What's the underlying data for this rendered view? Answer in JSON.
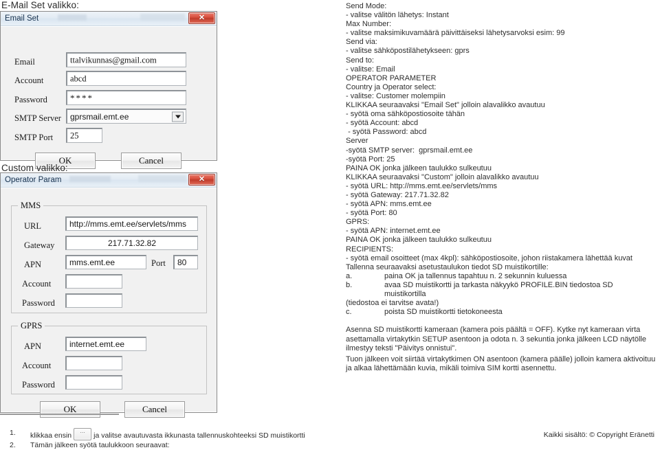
{
  "headings": {
    "email_menu": "E-Mail Set valikko:",
    "custom_menu": "Custom valikko:"
  },
  "email_dialog": {
    "title": "Email Set",
    "close_icon": "close-x-icon",
    "fields": [
      {
        "label": "Email",
        "value": "ttalvikunnas@gmail.com"
      },
      {
        "label": "Account",
        "value": "abcd"
      },
      {
        "label": "Password",
        "value": "****"
      },
      {
        "label": "SMTP Server",
        "value": "gprsmail.emt.ee"
      },
      {
        "label": "SMTP Port",
        "value": "25"
      }
    ],
    "buttons": {
      "ok": "OK",
      "cancel": "Cancel"
    }
  },
  "operator_dialog": {
    "title": "Operator Param",
    "close_icon": "close-x-icon",
    "mms": {
      "group_label": "MMS",
      "url_label": "URL",
      "url_value": "http://mms.emt.ee/servlets/mms",
      "gateway_label": "Gateway",
      "gateway_value": "217.71.32.82",
      "apn_label": "APN",
      "apn_value": "mms.emt.ee",
      "port_label": "Port",
      "port_value": "80",
      "account_label": "Account",
      "account_value": "",
      "password_label": "Password",
      "password_value": ""
    },
    "gprs": {
      "group_label": "GPRS",
      "apn_label": "APN",
      "apn_value": "internet.emt.ee",
      "account_label": "Account",
      "account_value": "",
      "password_label": "Password",
      "password_value": ""
    },
    "buttons": {
      "ok": "OK",
      "cancel": "Cancel"
    }
  },
  "instructions": {
    "lines": [
      "Send Mode:",
      "- valitse välitön lähetys: Instant",
      "Max Number:",
      "- valitse maksimikuvamäärä päivittäiseksi lähetysarvoksi esim: 99",
      "Send via:",
      "- valitse sähköpostilähetykseen: gprs",
      "Send to:",
      "- valitse: Email",
      "OPERATOR PARAMETER",
      "Country ja Operator select:",
      "- valitse: Customer molempiin",
      "KLIKKAA seuraavaksi \"Email Set\" jolloin alavalikko avautuu",
      "- syötä oma sähköpostiosoite tähän",
      "- syötä Account: abcd",
      " - syötä Password: abcd",
      "Server",
      "-syötä SMTP server:  gprsmail.emt.ee",
      "-syötä Port: 25",
      "PAINA OK jonka jälkeen taulukko sulkeutuu",
      "KLIKKAA seuraavaksi \"Custom\" jolloin alavalikko avautuu",
      "- syötä URL: http://mms.emt.ee/servlets/mms",
      "- syötä Gateway: 217.71.32.82",
      "- syötä APN: mms.emt.ee",
      "- syötä Port: 80",
      "GPRS:",
      "- syötä APN: internet.emt.ee",
      "PAINA OK jonka jälkeen taulukko sulkeutuu",
      "RECIPIENTS:",
      "- syötä email osoitteet (max 4kpl): sähköpostiosoite, johon riistakamera lähettää kuvat",
      "Tallenna seuraavaksi asetustaulukon tiedot SD muistikortille:"
    ],
    "steps": [
      {
        "key": "a.",
        "text": "paina OK  ja tallennus tapahtuu n. 2 sekunnin kuluessa"
      },
      {
        "key": "b.",
        "text": "avaa SD muistikortti ja tarkasta näkyykö PROFILE.BIN tiedostoa SD muistikortilla"
      }
    ],
    "after_b": "(tiedostoa ei tarvitse avata!)",
    "step_c": {
      "key": "c.",
      "text": "poista SD muistikortti tietokoneesta"
    },
    "paragraph1": "Asenna SD muistikortti kameraan (kamera pois päältä = OFF). Kytke nyt kameraan virta asettamalla virtakytkin SETUP asentoon ja odota n. 3 sekuntia jonka jälkeen LCD näytölle ilmestyy teksti \"Päivitys onnistui\".",
    "paragraph2": "Tuon jälkeen voit siirtää virtakytkimen ON asentoon (kamera päälle) jolloin kamera aktivoituu ja alkaa lähettämään kuvia, mikäli toimiva SIM kortti asennettu."
  },
  "footer": {
    "item1_num": "1.",
    "item1_before": "klikkaa ensin",
    "item1_after": "ja valitse avautuvasta ikkunasta tallennuskohteeksi SD muistikortti",
    "item2_num": "2.",
    "item2_text": "Tämän jälkeen syötä taulukkoon seuraavat:",
    "copyright": "Kaikki sisältö: © Copyright Eränetti"
  },
  "colors": {
    "close_button": "#c03c2b",
    "titlebar": "#dae6f1",
    "window_bg": "#f1f1f1",
    "text": "#2e2e2e"
  }
}
